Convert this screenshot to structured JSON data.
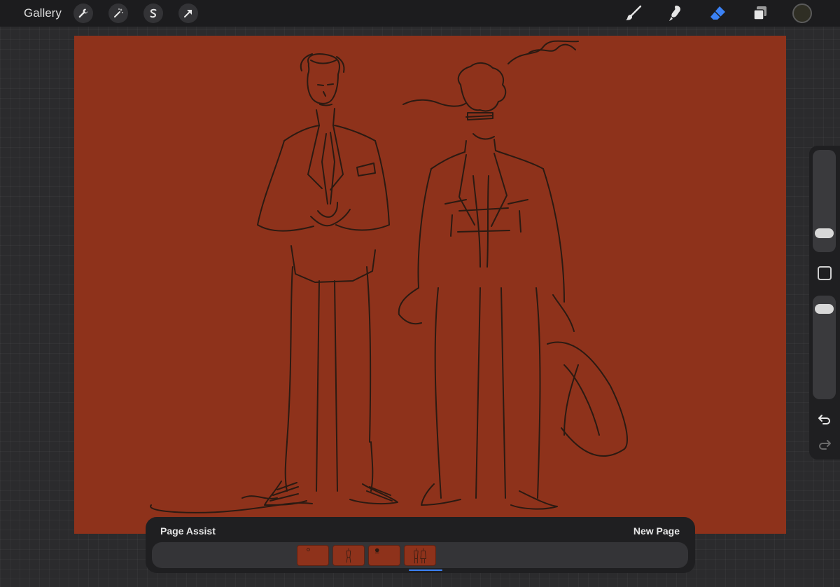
{
  "topbar": {
    "gallery_label": "Gallery",
    "left_tools": [
      {
        "icon": "wrench-icon"
      },
      {
        "icon": "magic-wand-icon"
      },
      {
        "icon": "selection-icon"
      },
      {
        "icon": "transform-arrow-icon"
      }
    ],
    "right_tools": [
      {
        "icon": "brush-icon"
      },
      {
        "icon": "smudge-icon"
      },
      {
        "icon": "eraser-icon",
        "active": true
      },
      {
        "icon": "layers-icon"
      }
    ],
    "active_color": "#2f2e24",
    "active_tool_color": "#3b82f6"
  },
  "canvas": {
    "background_color": "#8e321b",
    "stroke_color": "#2b1a12"
  },
  "sidebar": {
    "icons": [
      "undo-icon",
      "redo-icon"
    ]
  },
  "page_assist": {
    "title": "Page Assist",
    "new_page_label": "New Page",
    "pages": [
      {
        "index": 1,
        "active": false
      },
      {
        "index": 2,
        "active": false
      },
      {
        "index": 3,
        "active": false
      },
      {
        "index": 4,
        "active": true
      }
    ],
    "accent_color": "#3b82f6"
  }
}
